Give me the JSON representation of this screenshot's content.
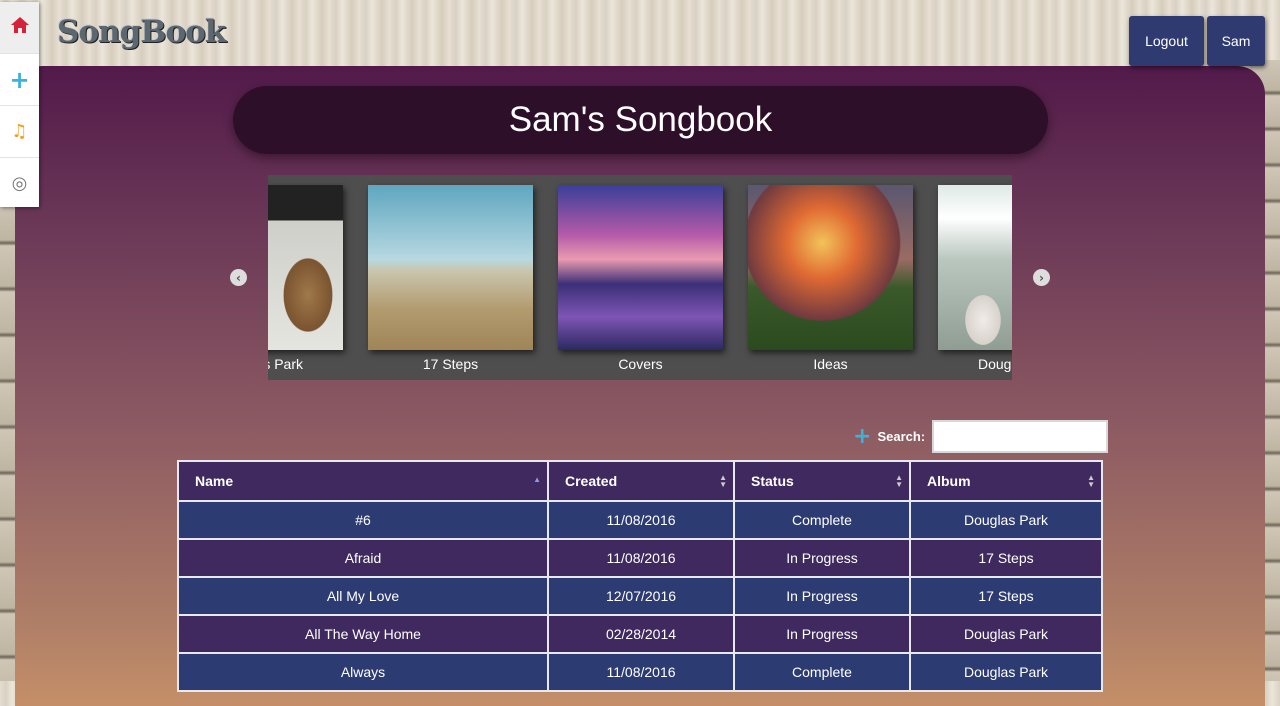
{
  "app": {
    "logo": "SongBook"
  },
  "sidebar": {
    "items": [
      {
        "name": "home",
        "icon": "home-icon",
        "glyph": "⌂"
      },
      {
        "name": "add",
        "icon": "plus-icon",
        "glyph": "+"
      },
      {
        "name": "songs",
        "icon": "music-icon",
        "glyph": "♫"
      },
      {
        "name": "record",
        "icon": "target-icon",
        "glyph": "◎"
      }
    ]
  },
  "header": {
    "logout_label": "Logout",
    "user_label": "Sam"
  },
  "main": {
    "title": "Sam's Songbook"
  },
  "carousel": {
    "prev_glyph": "‹",
    "next_glyph": "›",
    "slides": [
      {
        "caption": "Douglas Park",
        "visible_caption": "s Park"
      },
      {
        "caption": "17 Steps"
      },
      {
        "caption": "Covers"
      },
      {
        "caption": "Ideas"
      },
      {
        "caption": "Douglas Park",
        "visible_caption": "Doug"
      }
    ]
  },
  "search": {
    "label": "Search:",
    "value": ""
  },
  "table": {
    "columns": [
      "Name",
      "Created",
      "Status",
      "Album"
    ],
    "rows": [
      [
        "#6",
        "11/08/2016",
        "Complete",
        "Douglas Park"
      ],
      [
        "Afraid",
        "11/08/2016",
        "In Progress",
        "17 Steps"
      ],
      [
        "All My Love",
        "12/07/2016",
        "In Progress",
        "17 Steps"
      ],
      [
        "All The Way Home",
        "02/28/2014",
        "In Progress",
        "Douglas Park"
      ],
      [
        "Always",
        "11/08/2016",
        "Complete",
        "Douglas Park"
      ]
    ]
  },
  "colors": {
    "accent_blue": "#2f3a70",
    "row_purple": "#40295f",
    "row_blue": "#2d3b73",
    "home_red": "#d6213a",
    "plus_cyan": "#3bb3d8",
    "music_orange": "#f0a020"
  }
}
